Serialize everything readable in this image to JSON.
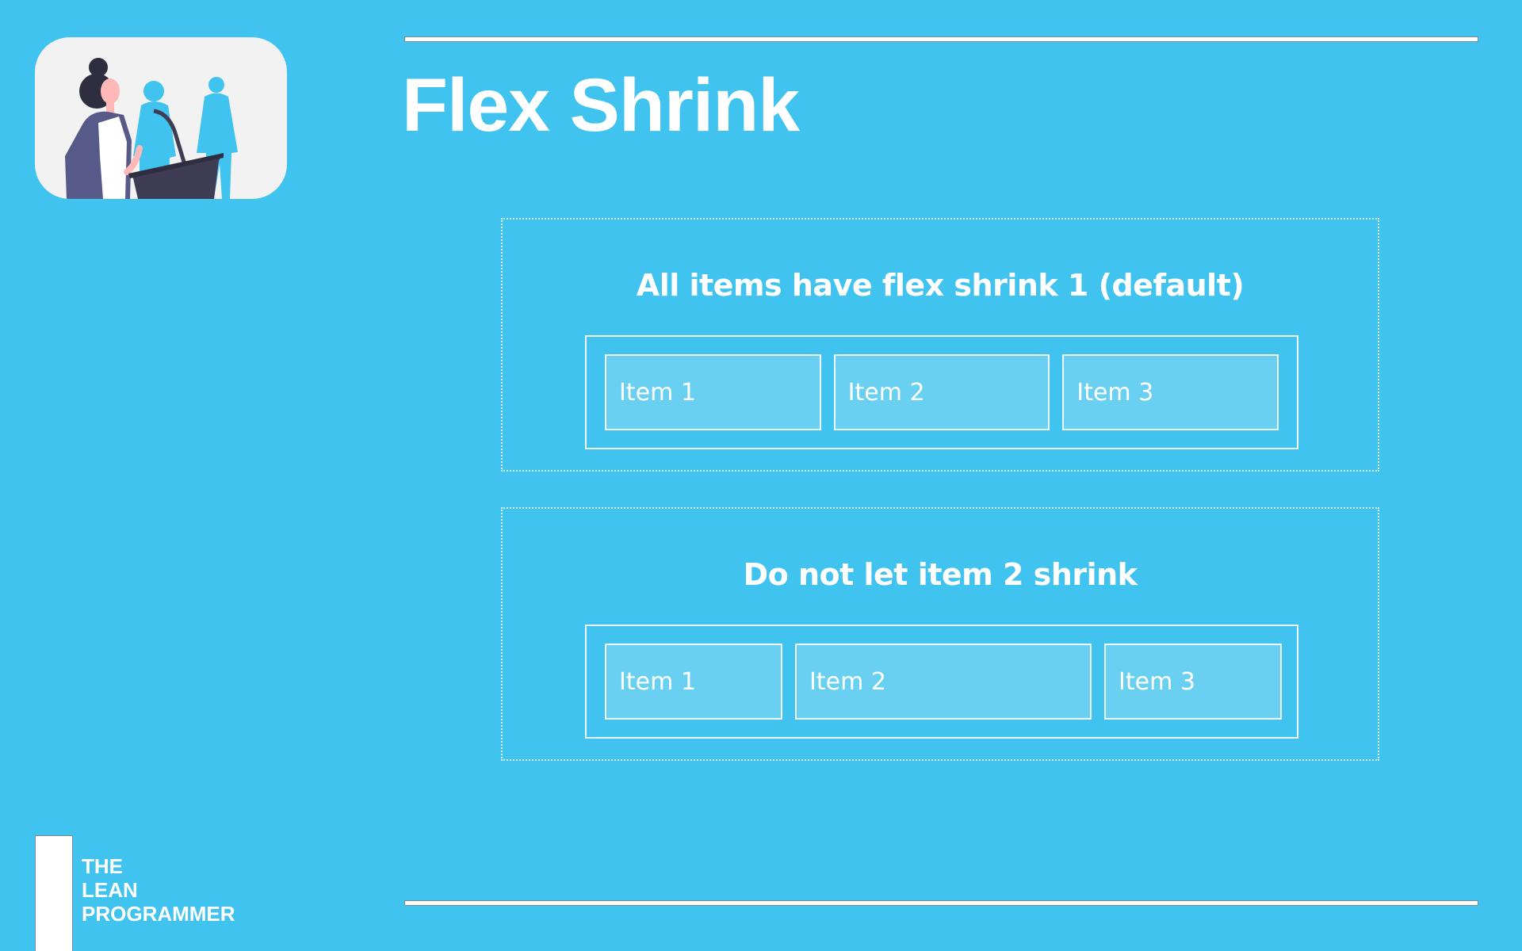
{
  "slide": {
    "title": "Flex Shrink",
    "colors": {
      "background": "#41C3EF",
      "text": "#FFFFFF",
      "illustration_card": "#F2F2F2"
    }
  },
  "panels": [
    {
      "heading": "All items have flex shrink 1 (default)",
      "items": [
        "Item 1",
        "Item 2",
        "Item 3"
      ]
    },
    {
      "heading": "Do not let item 2 shrink",
      "items": [
        "Item 1",
        "Item 2",
        "Item 3"
      ]
    }
  ],
  "brand": {
    "lines": [
      "THE",
      "LEAN",
      "PROGRAMMER"
    ]
  }
}
